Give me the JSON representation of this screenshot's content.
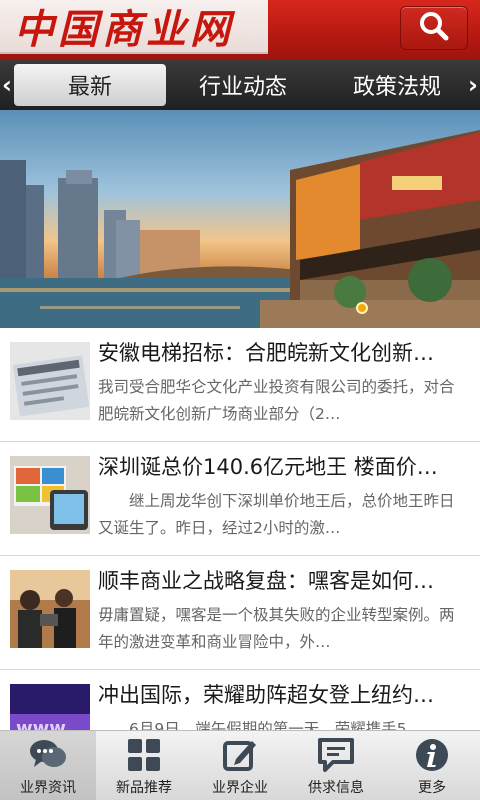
{
  "header": {
    "logo_text": "中国商业网",
    "search_icon": "search-icon"
  },
  "tabs": {
    "left_arrow": "‹",
    "right_arrow": "›",
    "items": [
      {
        "label": "最新",
        "active": true
      },
      {
        "label": "行业动态",
        "active": false
      },
      {
        "label": "政策法规",
        "active": false
      }
    ]
  },
  "news": [
    {
      "title": "安徽电梯招标：合肥皖新文化创新…",
      "desc": "我司受合肥华仑文化产业投资有限公司的委托，对合肥皖新文化创新广场商业部分（2…"
    },
    {
      "title": "深圳诞总价140.6亿元地王 楼面价…",
      "desc": "　　继上周龙华创下深圳单价地王后，总价地王昨日又诞生了。昨日，经过2小时的激…"
    },
    {
      "title": "顺丰商业之战略复盘：嘿客是如何…",
      "desc": "毋庸置疑，嘿客是一个极其失败的企业转型案例。两年的激进变革和商业冒险中，外…"
    },
    {
      "title": "冲出国际，荣耀助阵超女登上纽约…",
      "desc": "　　6月9日，端午假期的第一天，荣耀携手5…"
    }
  ],
  "bottom_nav": [
    {
      "label": "业界资讯",
      "icon": "chat-bubbles-icon",
      "active": true
    },
    {
      "label": "新品推荐",
      "icon": "grid-icon",
      "active": false
    },
    {
      "label": "业界企业",
      "icon": "edit-icon",
      "active": false
    },
    {
      "label": "供求信息",
      "icon": "message-icon",
      "active": false
    },
    {
      "label": "更多",
      "icon": "info-icon",
      "active": false
    }
  ],
  "colors": {
    "header_red": "#c7160d",
    "tab_bar": "#2a2a2a"
  }
}
